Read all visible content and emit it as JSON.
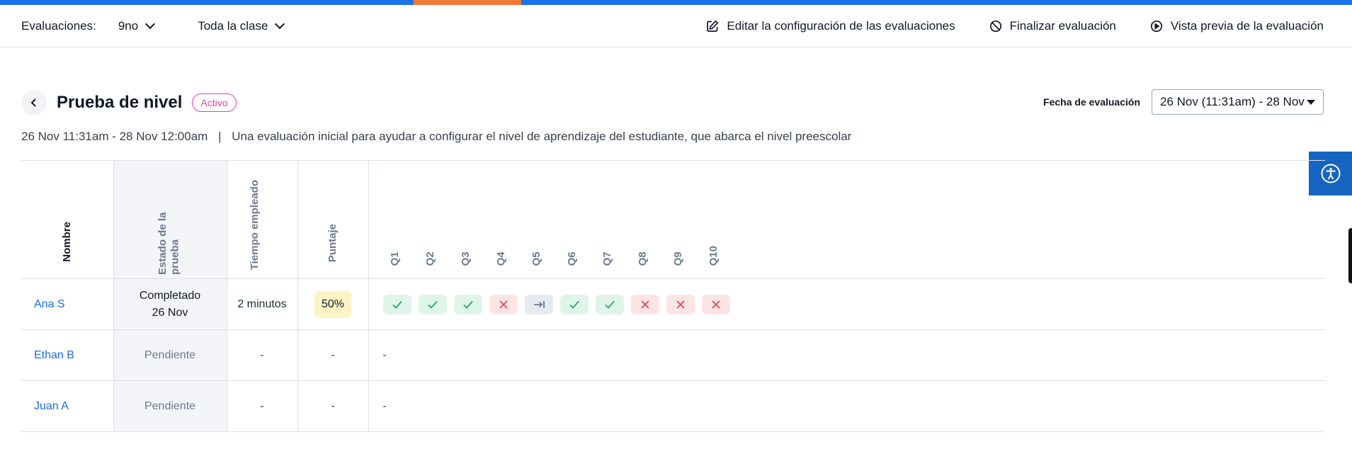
{
  "toolbar": {
    "evaluations_label": "Evaluaciones:",
    "grade_value": "9no",
    "class_value": "Toda la clase",
    "edit_settings": "Editar la configuración de las evaluaciones",
    "finish_evaluation": "Finalizar evaluación",
    "preview_evaluation": "Vista previa de la evaluación"
  },
  "header": {
    "title": "Prueba de nivel",
    "status_badge": "Activo",
    "date_label": "Fecha de evaluación",
    "date_value": "26 Nov (11:31am) - 28 Nov",
    "date_range": "26 Nov 11:31am - 28 Nov 12:00am",
    "separator": "|",
    "description": "Una evaluación inicial para ayudar a configurar el nivel de aprendizaje del estudiante, que abarca el nivel preescolar"
  },
  "table": {
    "headers": {
      "name": "Nombre",
      "state": "Estado de la prueba",
      "time": "Tiempo empleado",
      "score": "Puntaje",
      "questions": [
        "Q1",
        "Q2",
        "Q3",
        "Q4",
        "Q5",
        "Q6",
        "Q7",
        "Q8",
        "Q9",
        "Q10"
      ]
    },
    "rows": [
      {
        "name": "Ana S",
        "state_line1": "Completado",
        "state_line2": "26 Nov",
        "time": "2 minutos",
        "score": "50%",
        "answers": [
          "correct",
          "correct",
          "correct",
          "wrong",
          "skipped",
          "correct",
          "correct",
          "wrong",
          "wrong",
          "wrong"
        ]
      },
      {
        "name": "Ethan B",
        "state_line1": "Pendiente",
        "time": "-",
        "score": "-",
        "answers_placeholder": "-"
      },
      {
        "name": "Juan A",
        "state_line1": "Pendiente",
        "time": "-",
        "score": "-",
        "answers_placeholder": "-"
      }
    ]
  },
  "colors": {
    "top_bar": "#1a73e8",
    "top_bar_accent": "#f27935",
    "link": "#1a6ee0",
    "badge": "#e040b0",
    "correct": "#1fa968",
    "wrong": "#e5484d",
    "accessibility_button": "#1565c0"
  },
  "icons": {
    "back": "chevron-left-icon",
    "edit": "edit-pencil-icon",
    "finish": "ban-icon",
    "preview": "play-circle-icon",
    "accessibility": "accessibility-icon",
    "correct": "check-icon",
    "wrong": "x-icon",
    "skipped": "skip-arrow-icon"
  }
}
